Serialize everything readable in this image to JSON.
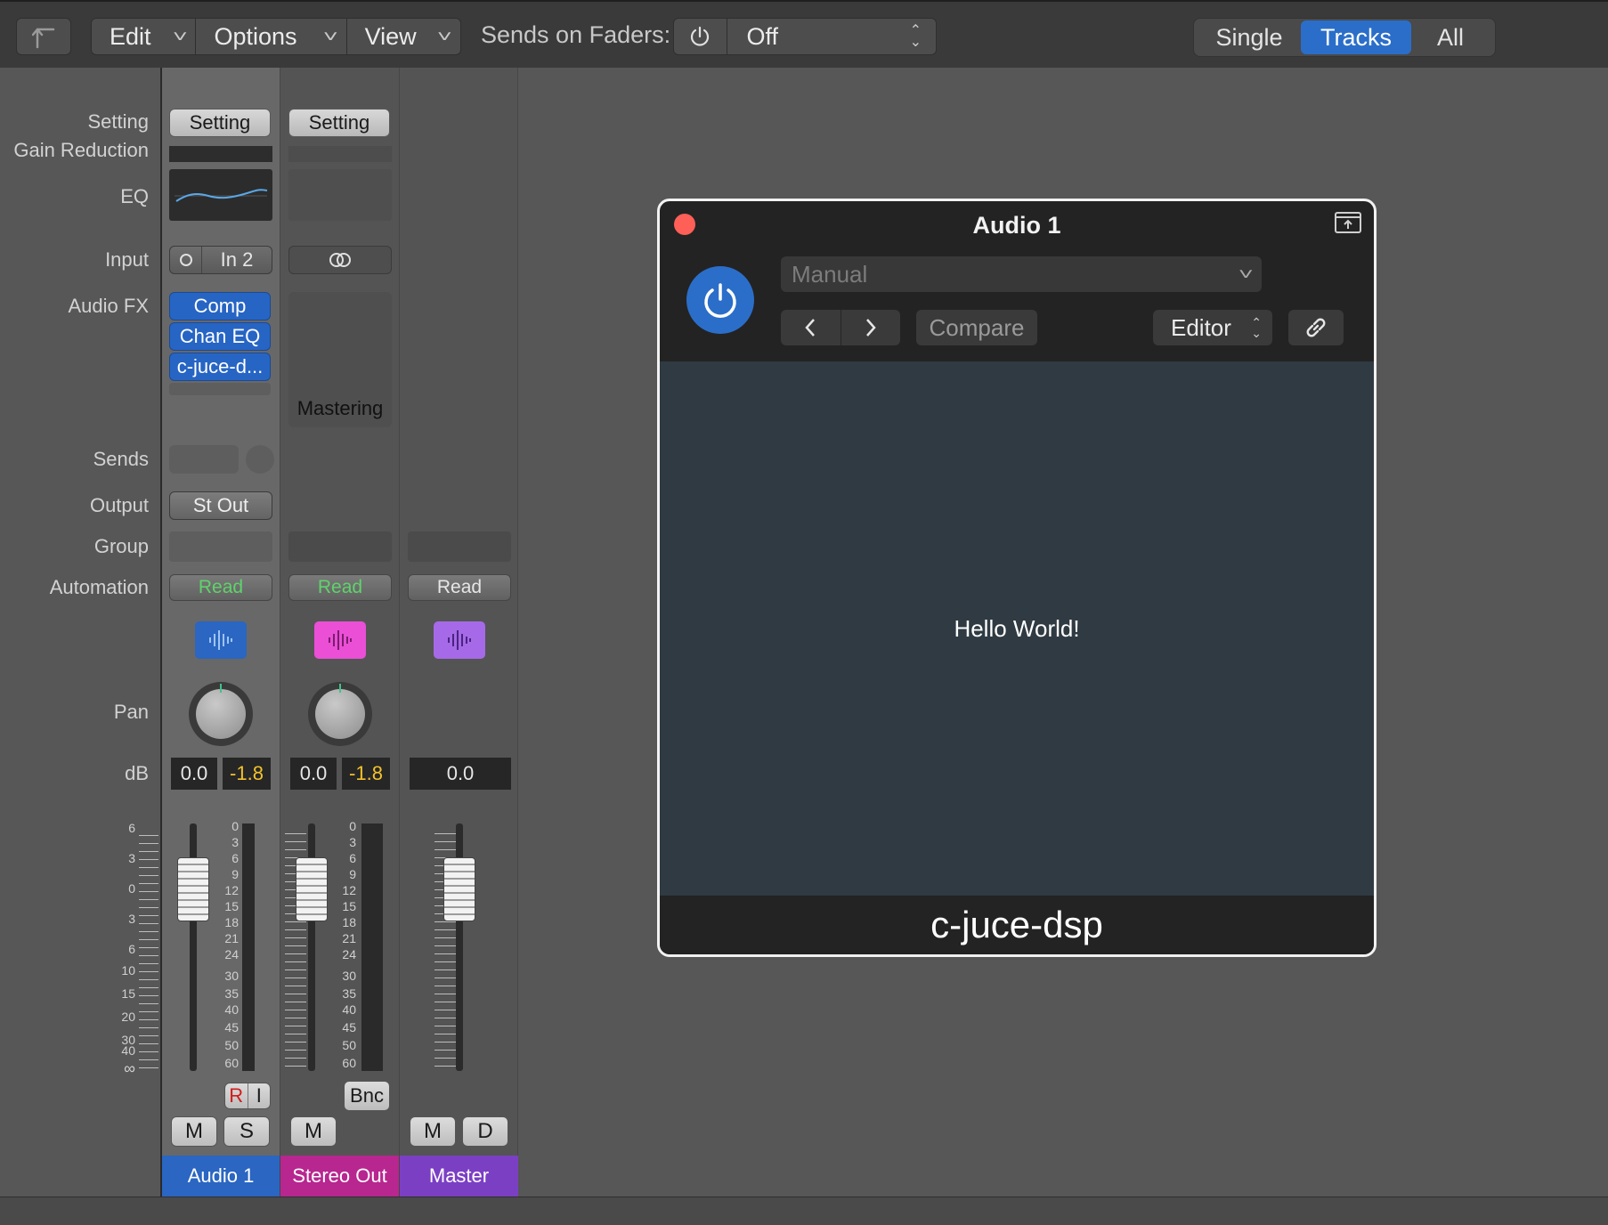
{
  "toolbar": {
    "back_icon": "up-arrow-icon",
    "menus": [
      {
        "label": "Edit"
      },
      {
        "label": "Options"
      },
      {
        "label": "View"
      }
    ],
    "sends_label": "Sends on Faders:",
    "sends_value": "Off",
    "view_modes": [
      "Single",
      "Tracks",
      "All"
    ],
    "active_view_mode": "Tracks"
  },
  "row_labels": {
    "setting": "Setting",
    "gain_reduction": "Gain Reduction",
    "eq": "EQ",
    "input": "Input",
    "audio_fx": "Audio FX",
    "sends": "Sends",
    "output": "Output",
    "group": "Group",
    "automation": "Automation",
    "pan": "Pan",
    "db": "dB"
  },
  "strips": [
    {
      "name": "Audio 1",
      "name_color": "#2a66c2",
      "setting": "Setting",
      "input": "In 2",
      "fx": [
        "Comp",
        "Chan EQ",
        "c-juce-d..."
      ],
      "output": "St Out",
      "automation": "Read",
      "icon_color": "#2a66c2",
      "volume": "0.0",
      "peak": "-1.8",
      "buttons": [
        "M",
        "S"
      ],
      "ri": [
        "R",
        "I"
      ]
    },
    {
      "name": "Stereo Out",
      "name_color": "#b8268f",
      "setting": "Setting",
      "fx_label": "Mastering",
      "automation": "Read",
      "icon_color": "#ea4fd6",
      "volume": "0.0",
      "peak": "-1.8",
      "buttons": [
        "M"
      ],
      "bnc": "Bnc"
    },
    {
      "name": "Master",
      "name_color": "#7b3fc4",
      "automation": "Read",
      "icon_color": "#a66ae8",
      "volume": "0.0",
      "buttons": [
        "M",
        "D"
      ]
    }
  ],
  "fader_scale": [
    "6",
    "3",
    "0",
    "3",
    "6",
    "10",
    "15",
    "20",
    "30",
    "40",
    "∞"
  ],
  "meter_scale": [
    "0",
    "3",
    "6",
    "9",
    "12",
    "15",
    "18",
    "21",
    "24",
    "30",
    "35",
    "40",
    "45",
    "50",
    "60"
  ],
  "plugin": {
    "title": "Audio 1",
    "preset": "Manual",
    "compare": "Compare",
    "view": "Editor",
    "body_text": "Hello World!",
    "footer": "c-juce-dsp"
  }
}
